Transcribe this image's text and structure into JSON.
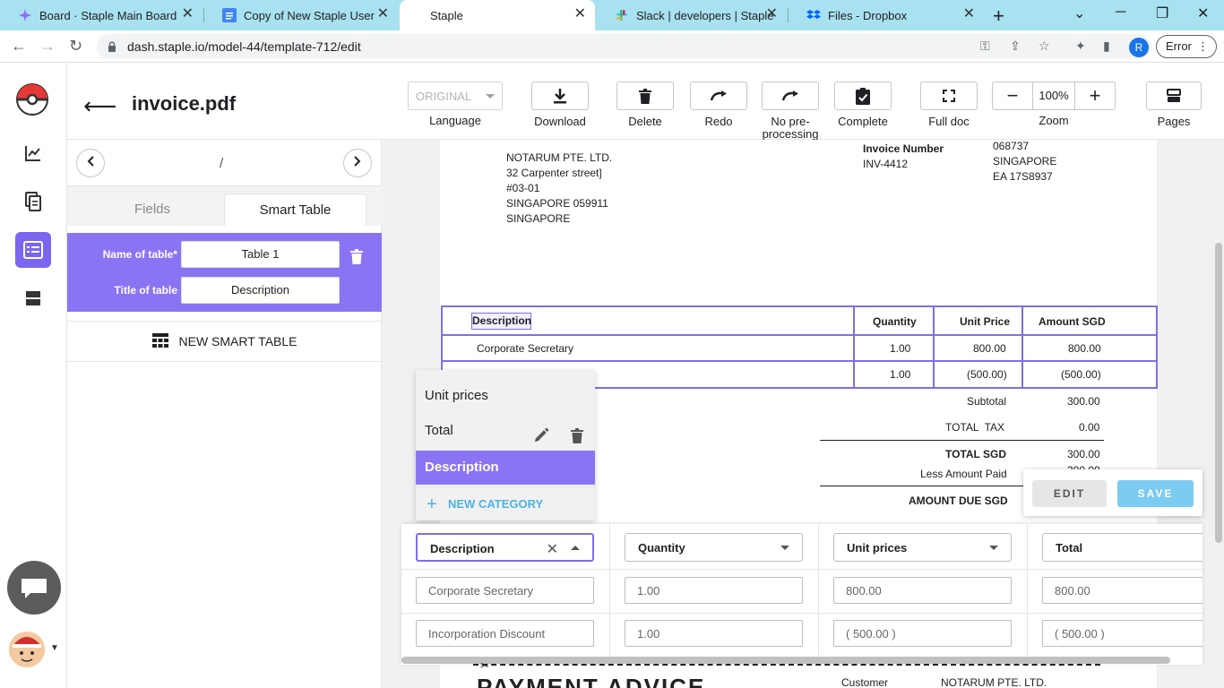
{
  "browser": {
    "tabs": [
      {
        "label": "Board · Staple Main Board",
        "icon": "staple-icon",
        "active": false
      },
      {
        "label": "Copy of New Staple User Ma",
        "icon": "google-docs-icon",
        "active": false
      },
      {
        "label": "Staple",
        "icon": "",
        "active": true
      },
      {
        "label": "Slack | developers | Staple",
        "icon": "slack-icon",
        "active": false
      },
      {
        "label": "Files - Dropbox",
        "icon": "dropbox-icon",
        "active": false
      }
    ],
    "url": "dash.staple.io/model-44/template-712/edit",
    "profile_initial": "R",
    "error_label": "Error",
    "colors": {
      "tabbar": "#a8e1ef",
      "accent": "#8b74f4"
    }
  },
  "header": {
    "title": "invoice.pdf",
    "language_value": "ORIGINAL",
    "language_label": "Language",
    "tools": {
      "download": "Download",
      "delete": "Delete",
      "redo": "Redo",
      "no_preprocessing": "No pre-processing",
      "no_pre_line1": "No pre-",
      "no_pre_line2": "processing",
      "complete": "Complete",
      "full_doc": "Full doc",
      "zoom": "Zoom",
      "pages": "Pages"
    },
    "zoom_value": "100%"
  },
  "sidepanel": {
    "pager_text": "/",
    "tabs": {
      "fields": "Fields",
      "smart_table": "Smart Table"
    },
    "table": {
      "name_label": "Name of table*",
      "name_value": "Table 1",
      "title_label": "Title of table",
      "title_value": "Description"
    },
    "new_smart_table": "NEW SMART TABLE"
  },
  "document": {
    "seller": [
      "NOTARUM PTE. LTD.",
      "32 Carpenter street]",
      "#03-01",
      "SINGAPORE 059911",
      "SINGAPORE"
    ],
    "invoice_number_label": "Invoice Number",
    "invoice_number": "INV-4412",
    "right_block": [
      "068737",
      "SINGAPORE",
      "EA 17S8937"
    ],
    "table": {
      "headers": [
        "Description",
        "Quantity",
        "Unit Price",
        "Amount SGD"
      ],
      "rows": [
        {
          "description": "Corporate Secretary",
          "quantity": "1.00",
          "unit_price": "800.00",
          "amount": "800.00"
        },
        {
          "description": "Incorporation Discount",
          "quantity": "1.00",
          "unit_price": "(500.00)",
          "amount": "(500.00)"
        }
      ]
    },
    "totals": {
      "subtotal_label": "Subtotal",
      "subtotal": "300.00",
      "tax_label": "TOTAL  TAX",
      "tax": "0.00",
      "total_label": "TOTAL SGD",
      "total": "300.00",
      "less_paid_label": "Less Amount Paid",
      "less_paid": "300.00",
      "due_label": "AMOUNT DUE SGD"
    },
    "payment_title": "PAYMENT ADVICE",
    "customer_label": "Customer",
    "customer_value": "NOTARUM PTE. LTD."
  },
  "category_menu": {
    "items": [
      "Unit prices",
      "Total",
      "Description"
    ],
    "selected": "Description",
    "new_category": "NEW CATEGORY"
  },
  "action_card": {
    "edit": "EDIT",
    "save": "SAVE"
  },
  "mapping_grid": {
    "columns": [
      "Description",
      "Quantity",
      "Unit prices",
      "Total"
    ],
    "rows": [
      [
        "Corporate Secretary",
        "1.00",
        "800.00",
        "800.00"
      ],
      [
        "Incorporation Discount",
        "1.00",
        "( 500.00 )",
        "( 500.00 )"
      ]
    ]
  }
}
